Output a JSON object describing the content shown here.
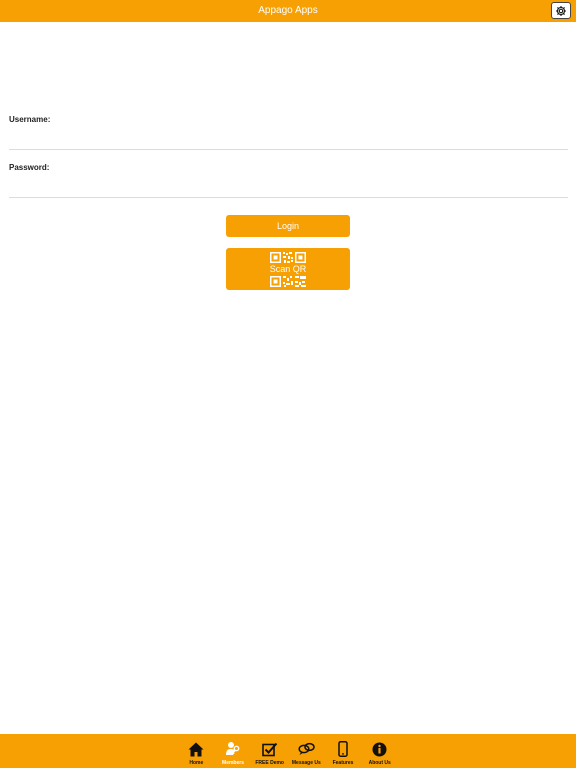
{
  "header": {
    "title": "Appago Apps",
    "settings_icon": "gear-icon"
  },
  "form": {
    "username_label": "Username:",
    "username_value": "",
    "password_label": "Password:",
    "password_value": ""
  },
  "buttons": {
    "login_label": "Login",
    "scan_label": "Scan QR",
    "scan_icon": "qr-code-icon"
  },
  "tabs": [
    {
      "label": "Home",
      "icon": "home-icon",
      "active": false
    },
    {
      "label": "Members",
      "icon": "members-icon",
      "active": true
    },
    {
      "label": "FREE Demo",
      "icon": "checkbox-icon",
      "active": false
    },
    {
      "label": "Message Us",
      "icon": "chat-icon",
      "active": false
    },
    {
      "label": "Features",
      "icon": "phone-icon",
      "active": false
    },
    {
      "label": "About Us",
      "icon": "info-icon",
      "active": false
    }
  ],
  "colors": {
    "accent": "#f7a003",
    "tab_active_text": "#ffffff",
    "tab_text": "#111111"
  }
}
